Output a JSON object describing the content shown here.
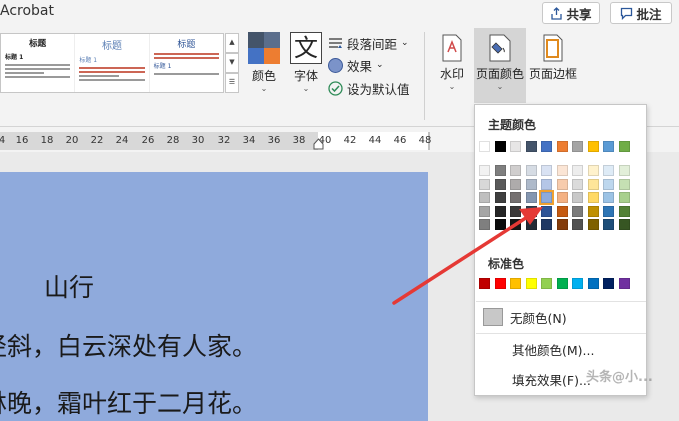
{
  "app": {
    "title": "Acrobat"
  },
  "top_buttons": {
    "share_label": "共享",
    "comment_label": "批注"
  },
  "style_gallery": {
    "thumbs": [
      {
        "title": "标题",
        "subtitle": "标题 1"
      },
      {
        "title": "标题",
        "subtitle": "标题 1"
      },
      {
        "title": "标题",
        "subtitle": "标题 1"
      }
    ]
  },
  "ribbon": {
    "colors_label": "颜色",
    "fonts_label": "字体",
    "fonts_glyph": "文",
    "paragraph_spacing_label": "段落间距",
    "effects_label": "效果",
    "set_default_label": "设为默认值",
    "watermark_label": "水印",
    "page_color_label": "页面颜色",
    "page_border_label": "页面边框"
  },
  "ruler": {
    "ticks": [
      "4",
      "16",
      "18",
      "20",
      "22",
      "24",
      "26",
      "28",
      "30",
      "32",
      "34",
      "36",
      "38",
      "40",
      "42",
      "44",
      "46",
      "48"
    ]
  },
  "document": {
    "title": "山行",
    "lines": [
      "径斜，白云深处有人家。",
      "林晚，霜叶红于二月花。"
    ]
  },
  "page_color_menu": {
    "theme_colors_heading": "主题颜色",
    "standard_colors_heading": "标准色",
    "no_color_label": "无颜色(N)",
    "more_colors_label": "其他颜色(M)...",
    "fill_effects_label": "填充效果(F)...",
    "theme_top_row": [
      "#ffffff",
      "#000000",
      "#e7e6e6",
      "#44546a",
      "#4472c4",
      "#ed7d31",
      "#a5a5a5",
      "#ffc000",
      "#5b9bd5",
      "#70ad47"
    ],
    "theme_shades": [
      [
        "#f2f2f2",
        "#7f7f7f",
        "#d0cece",
        "#d6dce4",
        "#d9e2f3",
        "#fbe5d5",
        "#ededed",
        "#fff2cc",
        "#deebf6",
        "#e2efd9"
      ],
      [
        "#d8d8d8",
        "#595959",
        "#aeabab",
        "#adb9ca",
        "#b4c6e7",
        "#f7cbac",
        "#dbdbdb",
        "#fee599",
        "#bdd7ee",
        "#c5e0b3"
      ],
      [
        "#bfbfbf",
        "#3f3f3f",
        "#757070",
        "#8496b0",
        "#8eaadb",
        "#f4b183",
        "#c9c9c9",
        "#ffd965",
        "#9cc3e5",
        "#a8d08d"
      ],
      [
        "#a5a5a5",
        "#262626",
        "#3a3838",
        "#323f4f",
        "#2f5496",
        "#c55a11",
        "#7b7b7b",
        "#bf9000",
        "#2e75b5",
        "#538135"
      ],
      [
        "#7f7f7f",
        "#0c0c0c",
        "#171616",
        "#222a35",
        "#1f3864",
        "#843c0b",
        "#525252",
        "#7f6000",
        "#1e4e79",
        "#375623"
      ]
    ],
    "standard_colors": [
      "#c00000",
      "#ff0000",
      "#ffc000",
      "#ffff00",
      "#92d050",
      "#00b050",
      "#00b0f0",
      "#0070c0",
      "#002060",
      "#7030a0"
    ],
    "selected": "#8eaadb"
  },
  "watermark_text": "头条@小...",
  "colors": {
    "accent": "#e04040",
    "page_fill": "#8faadc"
  }
}
